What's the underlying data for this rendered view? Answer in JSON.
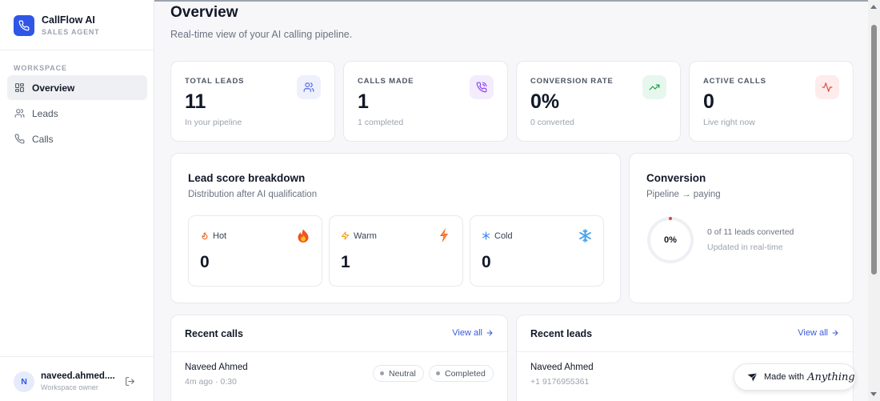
{
  "brand": {
    "title": "CallFlow AI",
    "subtitle": "SALES AGENT"
  },
  "sidebar": {
    "section_label": "WORKSPACE",
    "items": [
      {
        "label": "Overview",
        "icon": "grid-icon",
        "active": true
      },
      {
        "label": "Leads",
        "icon": "users-icon",
        "active": false
      },
      {
        "label": "Calls",
        "icon": "phone-icon",
        "active": false
      }
    ]
  },
  "user": {
    "initial": "N",
    "name": "naveed.ahmed....",
    "role": "Workspace owner"
  },
  "header": {
    "title": "Overview",
    "subtitle": "Real-time view of your AI calling pipeline."
  },
  "stats": [
    {
      "label": "TOTAL LEADS",
      "value": "11",
      "note": "In your pipeline",
      "icon": "users-icon",
      "color": "#4f6ae6",
      "bg": "#eef0fc"
    },
    {
      "label": "CALLS MADE",
      "value": "1",
      "note": "1 completed",
      "icon": "phone-call-icon",
      "color": "#8a3ffc",
      "bg": "#f3ecfd"
    },
    {
      "label": "CONVERSION RATE",
      "value": "0%",
      "note": "0 converted",
      "icon": "trending-up-icon",
      "color": "#16a34a",
      "bg": "#e8f7ee"
    },
    {
      "label": "ACTIVE CALLS",
      "value": "0",
      "note": "Live right now",
      "icon": "activity-icon",
      "color": "#e0443e",
      "bg": "#fdeceb"
    }
  ],
  "breakdown": {
    "title": "Lead score breakdown",
    "subtitle": "Distribution after AI qualification",
    "items": [
      {
        "label": "Hot",
        "value": "0",
        "icon": "flame-icon",
        "color": "#ea580c"
      },
      {
        "label": "Warm",
        "value": "1",
        "icon": "zap-icon",
        "color": "#f59e0b"
      },
      {
        "label": "Cold",
        "value": "0",
        "icon": "snowflake-icon",
        "color": "#3b82f6"
      }
    ]
  },
  "conversion": {
    "title": "Conversion",
    "subtitle": "Pipeline → paying",
    "percent_label": "0%",
    "percent": 0,
    "line1": "0 of 11 leads converted",
    "line2": "Updated in real-time"
  },
  "recent_calls": {
    "title": "Recent calls",
    "view_all": "View all",
    "rows": [
      {
        "name": "Naveed Ahmed",
        "meta": "4m ago · 0:30",
        "tags": [
          "Neutral",
          "Completed"
        ]
      }
    ]
  },
  "recent_leads": {
    "title": "Recent leads",
    "view_all": "View all",
    "rows": [
      {
        "name": "Naveed Ahmed",
        "meta": "+1 9176955361"
      }
    ]
  },
  "made_with": {
    "label": "Made with",
    "brand": "Anything"
  },
  "colors": {
    "accent": "#2f56e6",
    "link": "#3b5bdb"
  }
}
